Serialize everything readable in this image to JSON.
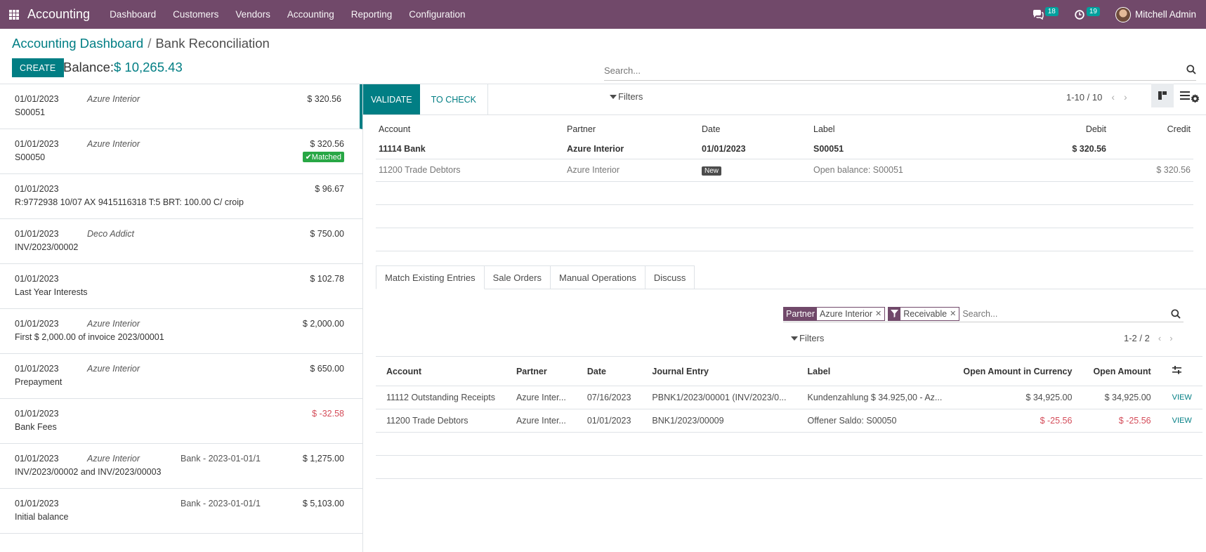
{
  "navbar": {
    "app_title": "Accounting",
    "menu": [
      "Dashboard",
      "Customers",
      "Vendors",
      "Accounting",
      "Reporting",
      "Configuration"
    ],
    "messages_count": "18",
    "activities_count": "19",
    "user_name": "Mitchell Admin",
    "color": "#71496a"
  },
  "control": {
    "breadcrumb_parent": "Accounting Dashboard",
    "breadcrumb_sep": "/",
    "breadcrumb_current": "Bank Reconciliation",
    "create_label": "CREATE",
    "balance_label": "Balance:",
    "balance_value": "$ 10,265.43",
    "search_placeholder": "Search...",
    "filters_label": "Filters",
    "pager": "1-10 / 10"
  },
  "statements": [
    {
      "date": "01/01/2023",
      "partner": "Azure Interior",
      "journal": "",
      "amount": "$ 320.56",
      "ref": "S00051",
      "matched": "",
      "negative": false
    },
    {
      "date": "01/01/2023",
      "partner": "Azure Interior",
      "journal": "",
      "amount": "$ 320.56",
      "ref": "S00050",
      "matched": "Matched",
      "negative": false
    },
    {
      "date": "01/01/2023",
      "partner": "",
      "journal": "",
      "amount": "$ 96.67",
      "ref": "R:9772938 10/07 AX 9415116318 T:5 BRT: 100.00 C/ croip",
      "matched": "",
      "negative": false
    },
    {
      "date": "01/01/2023",
      "partner": "Deco Addict",
      "journal": "",
      "amount": "$ 750.00",
      "ref": "INV/2023/00002",
      "matched": "",
      "negative": false
    },
    {
      "date": "01/01/2023",
      "partner": "",
      "journal": "",
      "amount": "$ 102.78",
      "ref": "Last Year Interests",
      "matched": "",
      "negative": false
    },
    {
      "date": "01/01/2023",
      "partner": "Azure Interior",
      "journal": "",
      "amount": "$ 2,000.00",
      "ref": "First $ 2,000.00 of invoice 2023/00001",
      "matched": "",
      "negative": false
    },
    {
      "date": "01/01/2023",
      "partner": "Azure Interior",
      "journal": "",
      "amount": "$ 650.00",
      "ref": "Prepayment",
      "matched": "",
      "negative": false
    },
    {
      "date": "01/01/2023",
      "partner": "",
      "journal": "",
      "amount": "$ -32.58",
      "ref": "Bank Fees",
      "matched": "",
      "negative": true
    },
    {
      "date": "01/01/2023",
      "partner": "Azure Interior",
      "journal": "Bank - 2023-01-01/1",
      "amount": "$ 1,275.00",
      "ref": "INV/2023/00002 and INV/2023/00003",
      "matched": "",
      "negative": false
    },
    {
      "date": "01/01/2023",
      "partner": "",
      "journal": "Bank - 2023-01-01/1",
      "amount": "$ 5,103.00",
      "ref": "Initial balance",
      "matched": "",
      "negative": false
    }
  ],
  "toolbar": {
    "validate_label": "VALIDATE",
    "tocheck_label": "TO CHECK"
  },
  "lines": {
    "headers": {
      "account": "Account",
      "partner": "Partner",
      "date": "Date",
      "label": "Label",
      "debit": "Debit",
      "credit": "Credit"
    },
    "rows": [
      {
        "account": "11114 Bank",
        "partner": "Azure Interior",
        "date": "01/01/2023",
        "label": "S00051",
        "debit": "$ 320.56",
        "credit": ""
      },
      {
        "account": "11200 Trade Debtors",
        "partner": "Azure Interior",
        "date": "New",
        "label": "Open balance: S00051",
        "debit": "",
        "credit": "$ 320.56"
      }
    ]
  },
  "tabs": [
    "Match Existing Entries",
    "Sale Orders",
    "Manual Operations",
    "Discuss"
  ],
  "match": {
    "facet_partner_label": "Partner",
    "facet_partner_value": "Azure Interior",
    "facet_filter_value": "Receivable",
    "search_placeholder": "Search...",
    "filters_label": "Filters",
    "pager": "1-2 / 2",
    "headers": {
      "account": "Account",
      "partner": "Partner",
      "date": "Date",
      "journal_entry": "Journal Entry",
      "label": "Label",
      "open_currency": "Open Amount in Currency",
      "open_amount": "Open Amount"
    },
    "rows": [
      {
        "account": "11112 Outstanding Receipts",
        "partner": "Azure Inter...",
        "date": "07/16/2023",
        "journal_entry": "PBNK1/2023/00001 (INV/2023/0...",
        "label": "Kundenzahlung $ 34.925,00 - Az...",
        "open_currency": "$ 34,925.00",
        "open_amount": "$ 34,925.00",
        "view": "VIEW",
        "negative": false
      },
      {
        "account": "11200 Trade Debtors",
        "partner": "Azure Inter...",
        "date": "01/01/2023",
        "journal_entry": "BNK1/2023/00009",
        "label": "Offener Saldo: S00050",
        "open_currency": "$ -25.56",
        "open_amount": "$ -25.56",
        "view": "VIEW",
        "negative": true
      }
    ]
  }
}
